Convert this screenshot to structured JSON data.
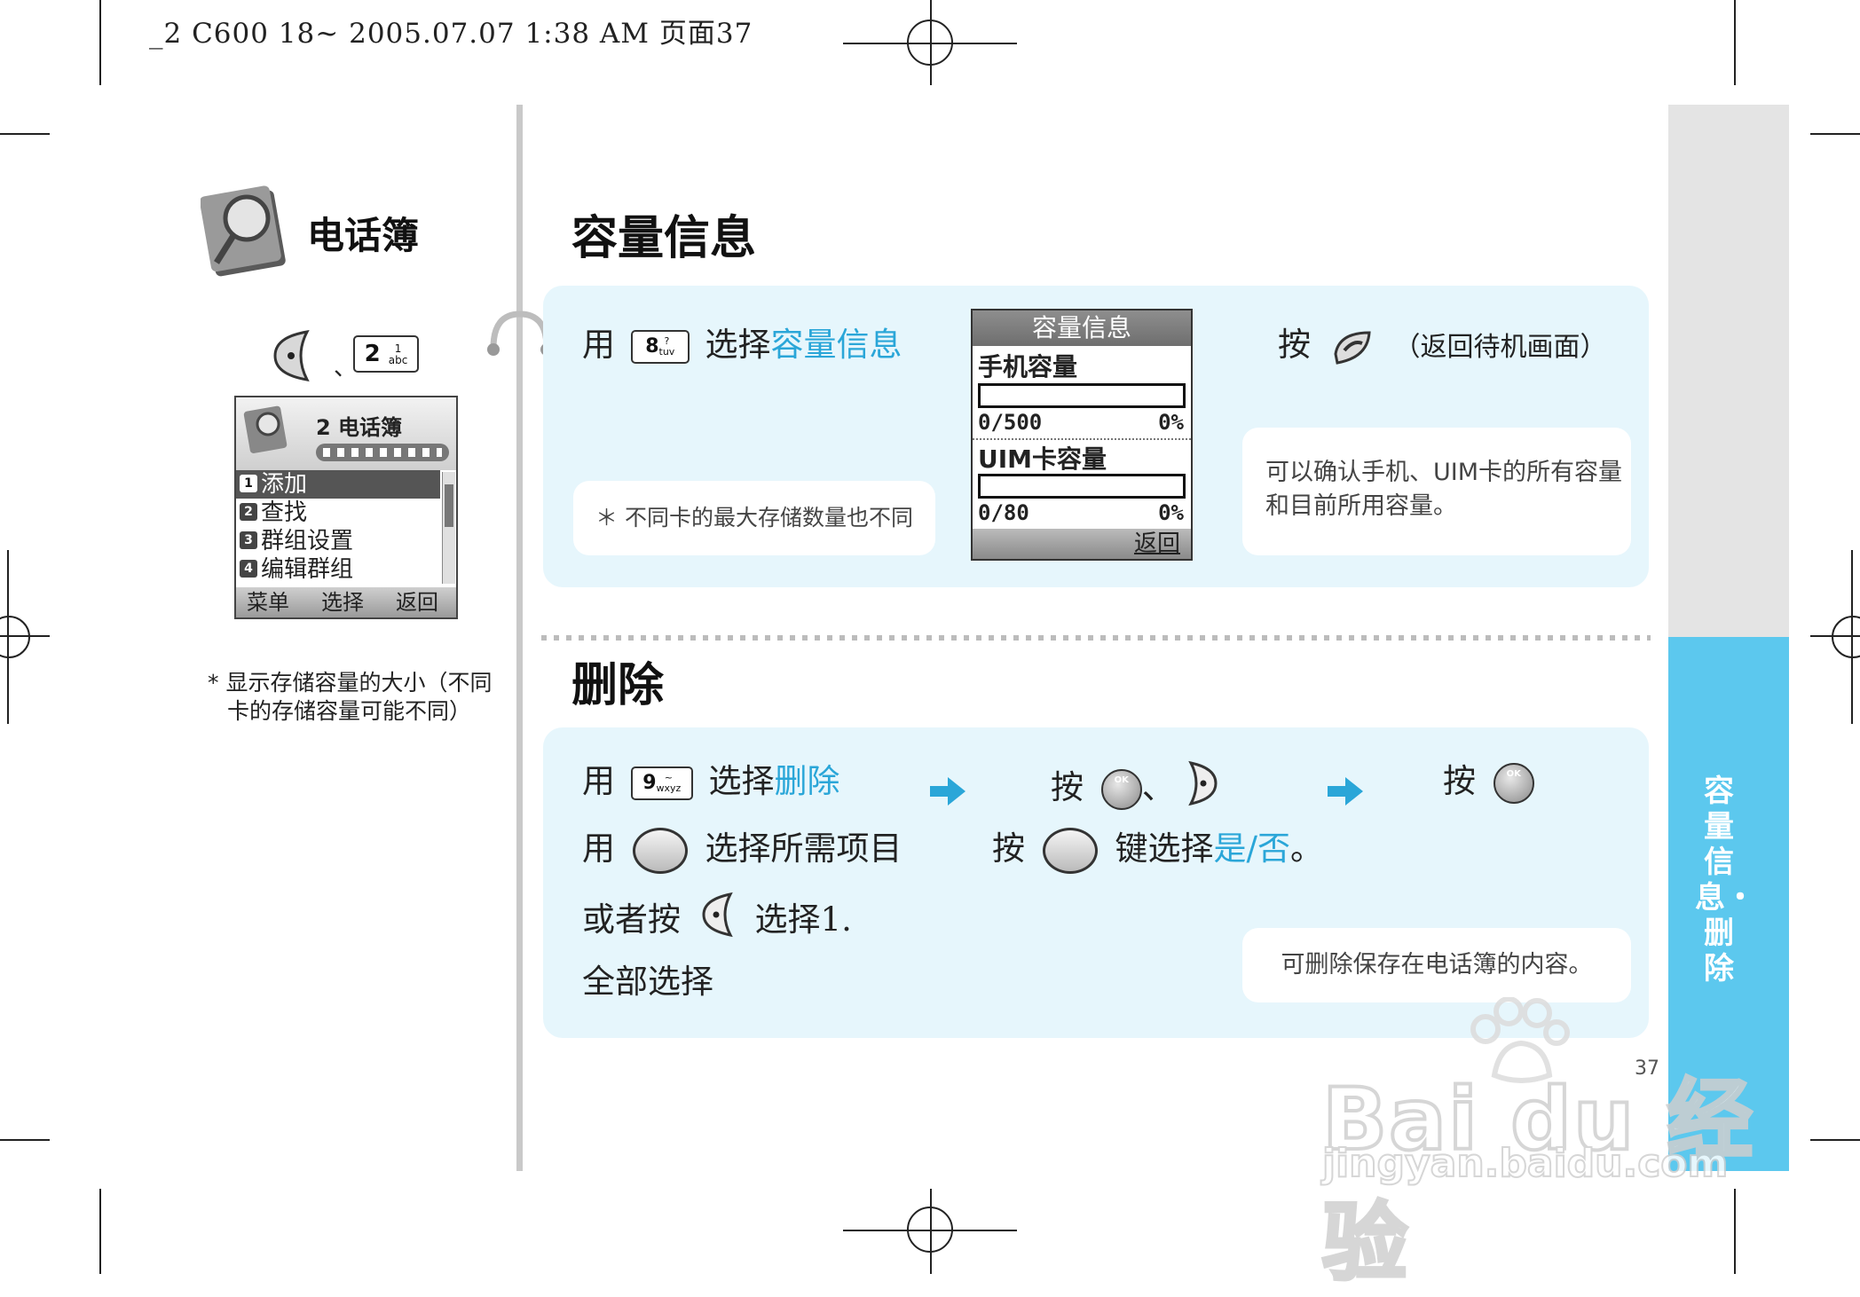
{
  "header_line": "_2 C600 18~  2005.07.07  1:38 AM  页面37",
  "section": {
    "title": "电话簿",
    "key_sep": "、",
    "key_label": "2",
    "key_sub_top": "1",
    "key_sub_bot": "abc",
    "menu_screen": {
      "title": "2 电话簿",
      "items": [
        "添加",
        "查找",
        "群组设置",
        "编辑群组"
      ],
      "item_nums": [
        "1",
        "2",
        "3",
        "4"
      ],
      "softkeys": [
        "菜单",
        "选择",
        "返回"
      ]
    },
    "footnote_line1": "* 显示存储容量的大小（不同",
    "footnote_line2": "卡的存储容量可能不同）"
  },
  "capacity": {
    "heading": "容量信息",
    "step1_prefix": "用",
    "key_label": "8",
    "key_sub_top": "?",
    "key_sub_bot": "tuv",
    "step1_mid": "选择",
    "step1_highlight": "容量信息",
    "note_left": "＊ 不同卡的最大存储数量也不同",
    "screen": {
      "title": "容量信息",
      "phone_label": "手机容量",
      "phone_count": "0/500",
      "phone_pct": "0%",
      "phone_fill": 0,
      "uim_label": "UIM卡容量",
      "uim_count": "0/80",
      "uim_pct": "0%",
      "uim_fill": 0,
      "softkey": "返回"
    },
    "step2_prefix": "按",
    "step2_note": "（返回待机画面）",
    "note_right_line1": "可以确认手机、UIM卡的所有容量",
    "note_right_line2": "和目前所用容量。"
  },
  "delete": {
    "heading": "删除",
    "row1_prefix": "用",
    "key_label": "9",
    "key_sub_top": "~",
    "key_sub_bot": "wxyz",
    "row1_mid": "选择",
    "row1_highlight": "删除",
    "row1_press": "按",
    "row1_sep": "、",
    "row1_press2": "按",
    "row2_prefix": "用",
    "row2_suffix": "选择所需项目",
    "row2_press": "按",
    "row2_mid": "键选择",
    "row2_highlight": "是/否",
    "row2_end": "。",
    "row3_prefix": "或者按",
    "row3_suffix": "选择1.",
    "row4": "全部选择",
    "note": "可删除保存在电话簿的内容。",
    "ok_label": "OK"
  },
  "side_tab": "容量信息・删除",
  "page_number": "37",
  "watermark": {
    "brand": "Bai du 经验",
    "url": "jingyan.baidu.com"
  }
}
